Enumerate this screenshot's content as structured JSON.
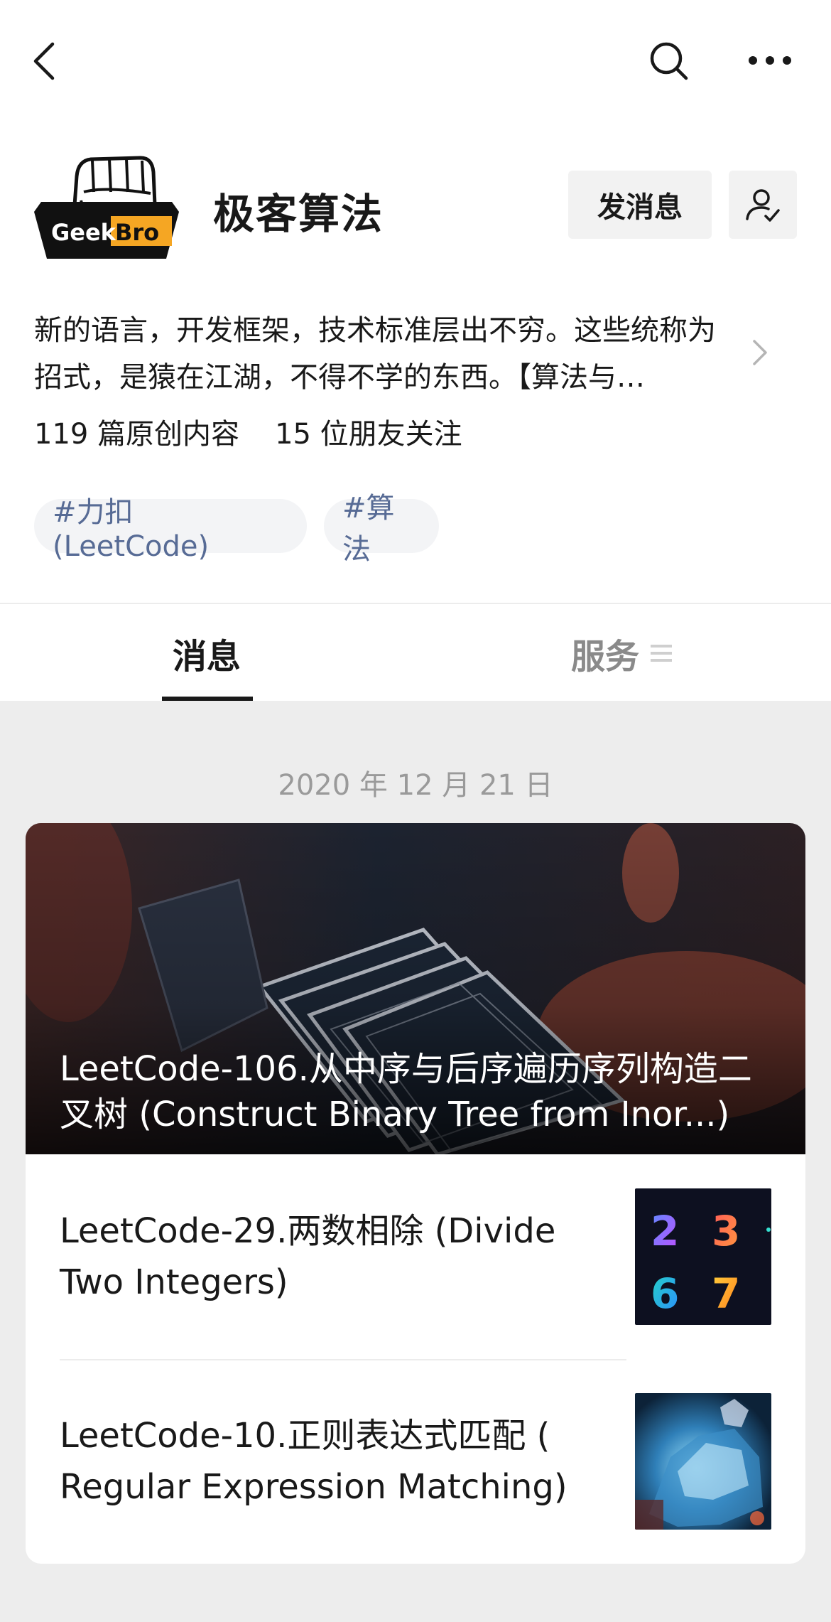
{
  "nav": {
    "back_icon": "chevron-left-icon",
    "search_icon": "search-icon",
    "more_icon": "more-horizontal-icon"
  },
  "profile": {
    "avatar_text_left": "Geek",
    "avatar_text_right": "Bro",
    "name": "极客算法",
    "message_button": "发消息",
    "follow_icon": "user-check-icon",
    "description": "新的语言，开发框架，技术标准层出不穷。这些统称为招式，是猿在江湖，不得不学的东西。【算法与…",
    "stats": [
      "119 篇原创内容",
      "15 位朋友关注"
    ],
    "tags": [
      "#力扣 (LeetCode)",
      "#算法"
    ]
  },
  "tabs": {
    "messages": "消息",
    "services": "服务"
  },
  "feed": {
    "date": "2020 年 12 月 21 日",
    "cover_title": "LeetCode-106.从中序与后序遍历序列构造二叉树 (Construct Binary Tree from Inor...)",
    "items": [
      {
        "title": "LeetCode-29.两数相除 (Divide Two Integers)",
        "thumb_digits": [
          "2",
          "3",
          "6",
          "7"
        ]
      },
      {
        "title": "LeetCode-10.正则表达式匹配 ( Regular Expression Matching)"
      }
    ]
  },
  "colors": {
    "accent_link": "#576b95",
    "background": "#ededed",
    "avatar_orange": "#f5a623"
  }
}
